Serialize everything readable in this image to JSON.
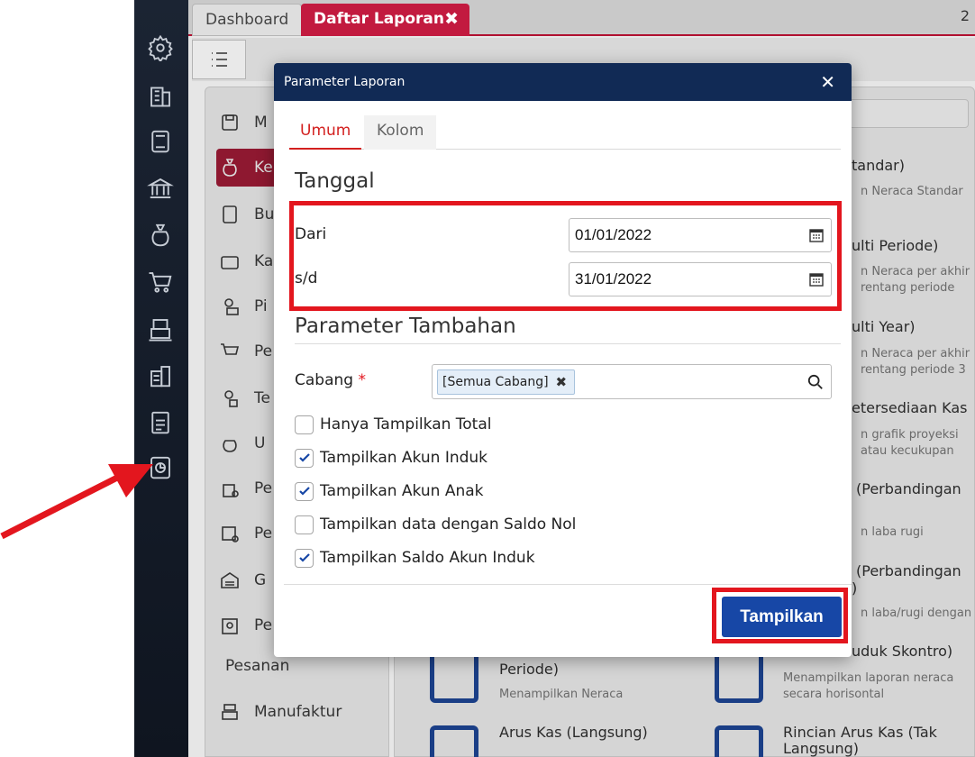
{
  "tabs": {
    "dashboard": "Dashboard",
    "active": "Daftar Laporan",
    "active_close": "✖",
    "page_number": "2"
  },
  "left_menu": {
    "items": [
      {
        "label": "M"
      },
      {
        "label": "Ke"
      },
      {
        "label": "Bu"
      },
      {
        "label": "Ka"
      },
      {
        "label": "Pi"
      },
      {
        "label": "Pe"
      },
      {
        "label": "Te"
      },
      {
        "label": "U"
      },
      {
        "label": "Pe"
      },
      {
        "label": "Pe"
      },
      {
        "label": "G"
      },
      {
        "label": "Pe"
      }
    ],
    "pesanan": "Pesanan",
    "manufaktur": "Manufaktur"
  },
  "background_cards": [
    {
      "title": "tandar)",
      "desc": "n Neraca Standar"
    },
    {
      "title": "ulti Periode)",
      "desc1": "n Neraca per akhir",
      "desc2": "rentang periode"
    },
    {
      "title": "ulti Year)",
      "desc1": "n Neraca per akhir",
      "desc2": "rentang periode 3"
    },
    {
      "title": "etersediaan Kas",
      "desc1": "n grafik proyeksi",
      "desc2": "atau kecukupan"
    },
    {
      "title": "(Perbandingan",
      "desc": "n laba rugi"
    },
    {
      "title": "(Perbandingan",
      "title2": ")",
      "desc": "n laba/rugi dengan"
    },
    {
      "title": "Periode)",
      "desc": "Menampilkan Neraca"
    },
    {
      "title": "uduk Skontro)",
      "desc1": "Menampilkan laporan neraca",
      "desc2": "secara horisontal"
    },
    {
      "title": "Arus Kas (Langsung)"
    },
    {
      "title": "Rincian Arus Kas (Tak",
      "title2": "Langsung)"
    }
  ],
  "modal": {
    "title": "Parameter Laporan",
    "close": "✕",
    "tabs": [
      "Umum",
      "Kolom"
    ],
    "section_tanggal": "Tanggal",
    "dari_label": "Dari",
    "dari_value": "01/01/2022",
    "sd_label": "s/d",
    "sd_value": "31/01/2022",
    "section_param": "Parameter Tambahan",
    "cabang_label": "Cabang",
    "cabang_required": "*",
    "cabang_chip": "[Semua Cabang]",
    "cabang_chip_remove": "✖",
    "checks": [
      {
        "label": "Hanya Tampilkan Total",
        "checked": false
      },
      {
        "label": "Tampilkan Akun Induk",
        "checked": true
      },
      {
        "label": "Tampilkan Akun Anak",
        "checked": true
      },
      {
        "label": "Tampilkan data dengan Saldo Nol",
        "checked": false
      },
      {
        "label": "Tampilkan Saldo Akun Induk",
        "checked": true
      }
    ],
    "submit": "Tampilkan"
  },
  "colors": {
    "header": "#112a55",
    "accent_red": "#e3161e",
    "button": "#1747a6",
    "active_tab": "#c21a3f"
  }
}
